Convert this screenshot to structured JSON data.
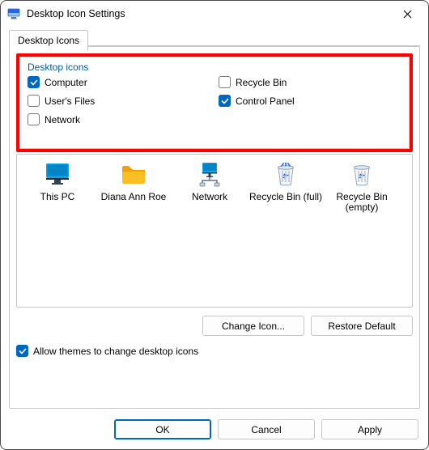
{
  "window": {
    "title": "Desktop Icon Settings"
  },
  "tabs": {
    "main": "Desktop Icons"
  },
  "group": {
    "legend": "Desktop icons",
    "items": [
      {
        "label": "Computer",
        "checked": true
      },
      {
        "label": "Recycle Bin",
        "checked": false
      },
      {
        "label": "User's Files",
        "checked": false
      },
      {
        "label": "Control Panel",
        "checked": true
      },
      {
        "label": "Network",
        "checked": false
      }
    ]
  },
  "preview": [
    {
      "label": "This PC"
    },
    {
      "label": "Diana Ann Roe"
    },
    {
      "label": "Network"
    },
    {
      "label": "Recycle Bin (full)"
    },
    {
      "label": "Recycle Bin (empty)"
    }
  ],
  "buttons": {
    "change_icon": "Change Icon...",
    "restore_default": "Restore Default",
    "ok": "OK",
    "cancel": "Cancel",
    "apply": "Apply"
  },
  "allow_themes": {
    "label": "Allow themes to change desktop icons",
    "checked": true
  }
}
